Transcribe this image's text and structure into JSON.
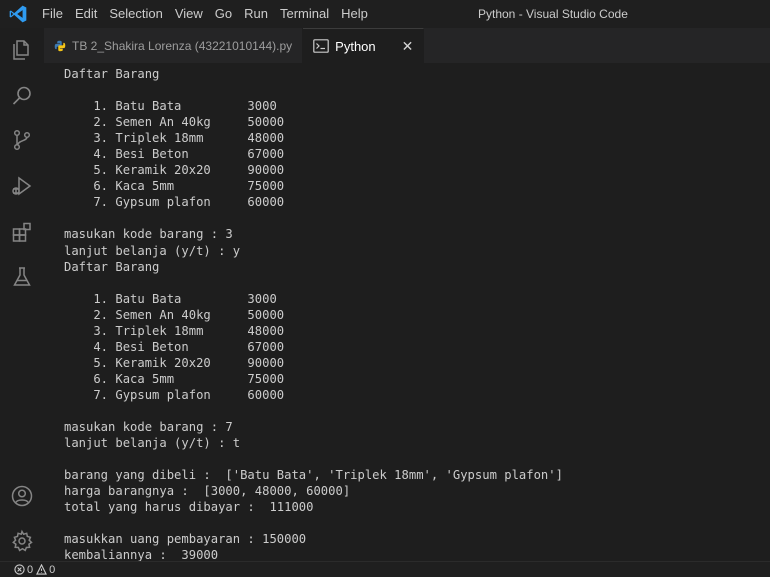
{
  "menu": [
    "File",
    "Edit",
    "Selection",
    "View",
    "Go",
    "Run",
    "Terminal",
    "Help"
  ],
  "window_title": "Python - Visual Studio Code",
  "tabs": [
    {
      "label": "TB 2_Shakira Lorenza (43221010144).py",
      "icon": "python-file-icon",
      "active": false
    },
    {
      "label": "Python",
      "icon": "terminal-icon",
      "active": true,
      "close": "✕"
    }
  ],
  "activity_bar": [
    "explorer-icon",
    "search-icon",
    "source-control-icon",
    "run-debug-icon",
    "extensions-icon",
    "testing-icon",
    "account-icon",
    "manage-gear-icon"
  ],
  "terminal_lines": [
    "Daftar Barang",
    "",
    "    1. Batu Bata         3000",
    "    2. Semen An 40kg     50000",
    "    3. Triplek 18mm      48000",
    "    4. Besi Beton        67000",
    "    5. Keramik 20x20     90000",
    "    6. Kaca 5mm          75000",
    "    7. Gypsum plafon     60000",
    "",
    "masukan kode barang : 3",
    "lanjut belanja (y/t) : y",
    "Daftar Barang",
    "",
    "    1. Batu Bata         3000",
    "    2. Semen An 40kg     50000",
    "    3. Triplek 18mm      48000",
    "    4. Besi Beton        67000",
    "    5. Keramik 20x20     90000",
    "    6. Kaca 5mm          75000",
    "    7. Gypsum plafon     60000",
    "",
    "masukan kode barang : 7",
    "lanjut belanja (y/t) : t",
    "",
    "barang yang dibeli :  ['Batu Bata', 'Triplek 18mm', 'Gypsum plafon']",
    "harga barangnya :  [3000, 48000, 60000]",
    "total yang harus dibayar :  111000",
    "",
    "masukkan uang pembayaran : 150000",
    "kembaliannya :  39000"
  ],
  "status": {
    "errors": "0",
    "warnings": "0"
  },
  "colors": {
    "accent": "#0078d4",
    "python_blue": "#3d7ab3",
    "python_yellow": "#f5c518"
  }
}
